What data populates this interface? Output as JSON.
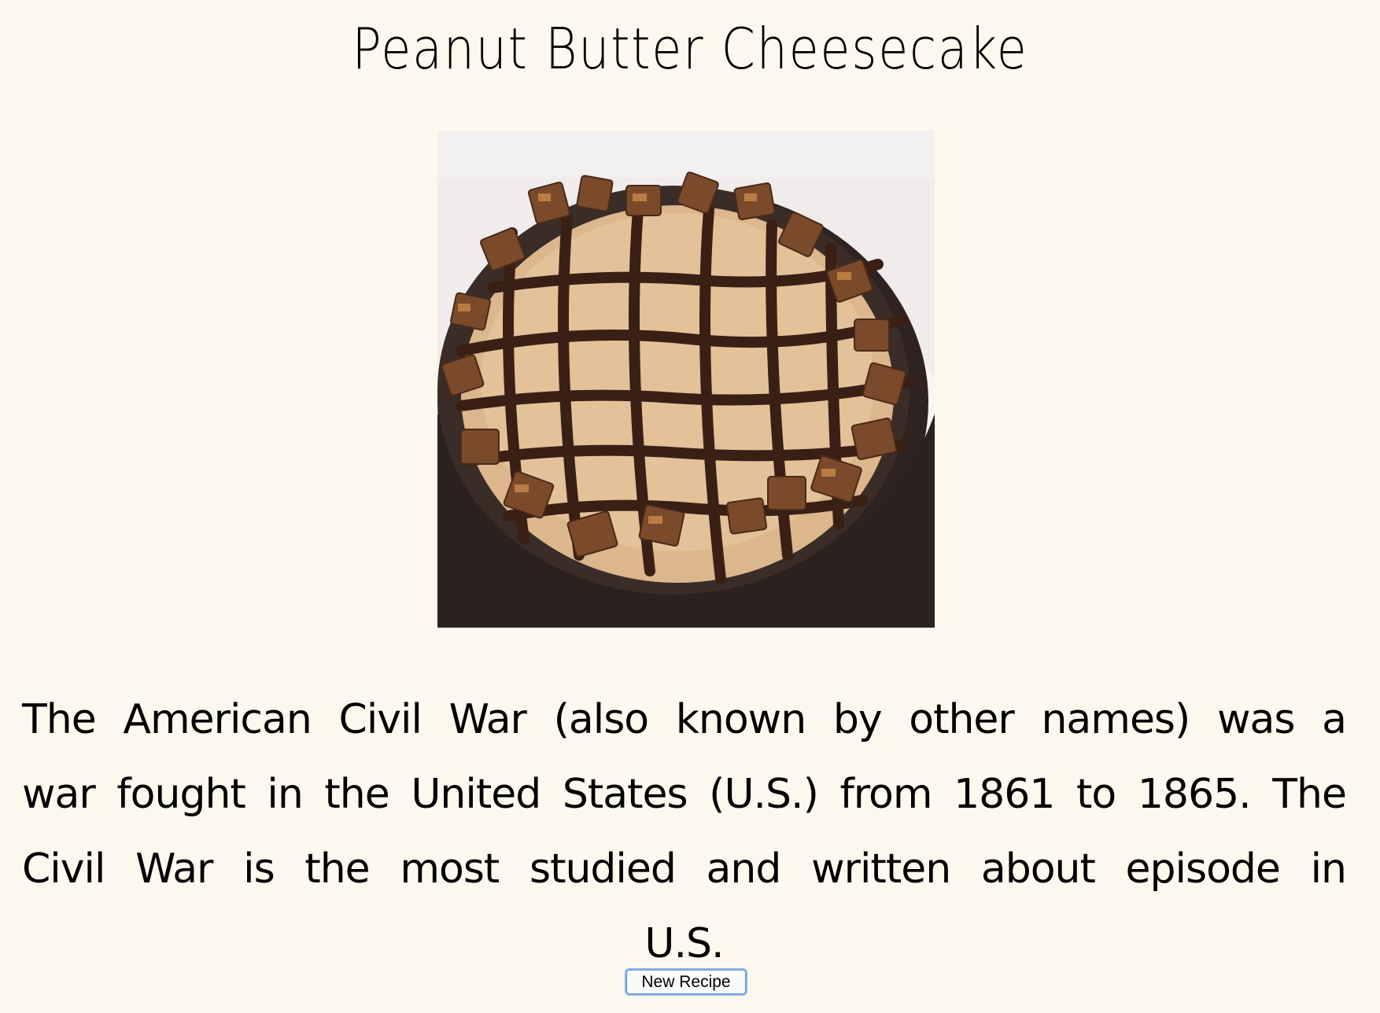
{
  "recipe": {
    "title": "Peanut Butter Cheesecake",
    "description": "The American Civil War (also known by other names) was a war fought in the United States (U.S.) from 1861 to 1865. The Civil War is the most studied and written about episode in U.S."
  },
  "actions": {
    "new_recipe_label": "New Recipe"
  },
  "colors": {
    "background": "#fdf8ee",
    "button_border": "#8fb5e8"
  }
}
